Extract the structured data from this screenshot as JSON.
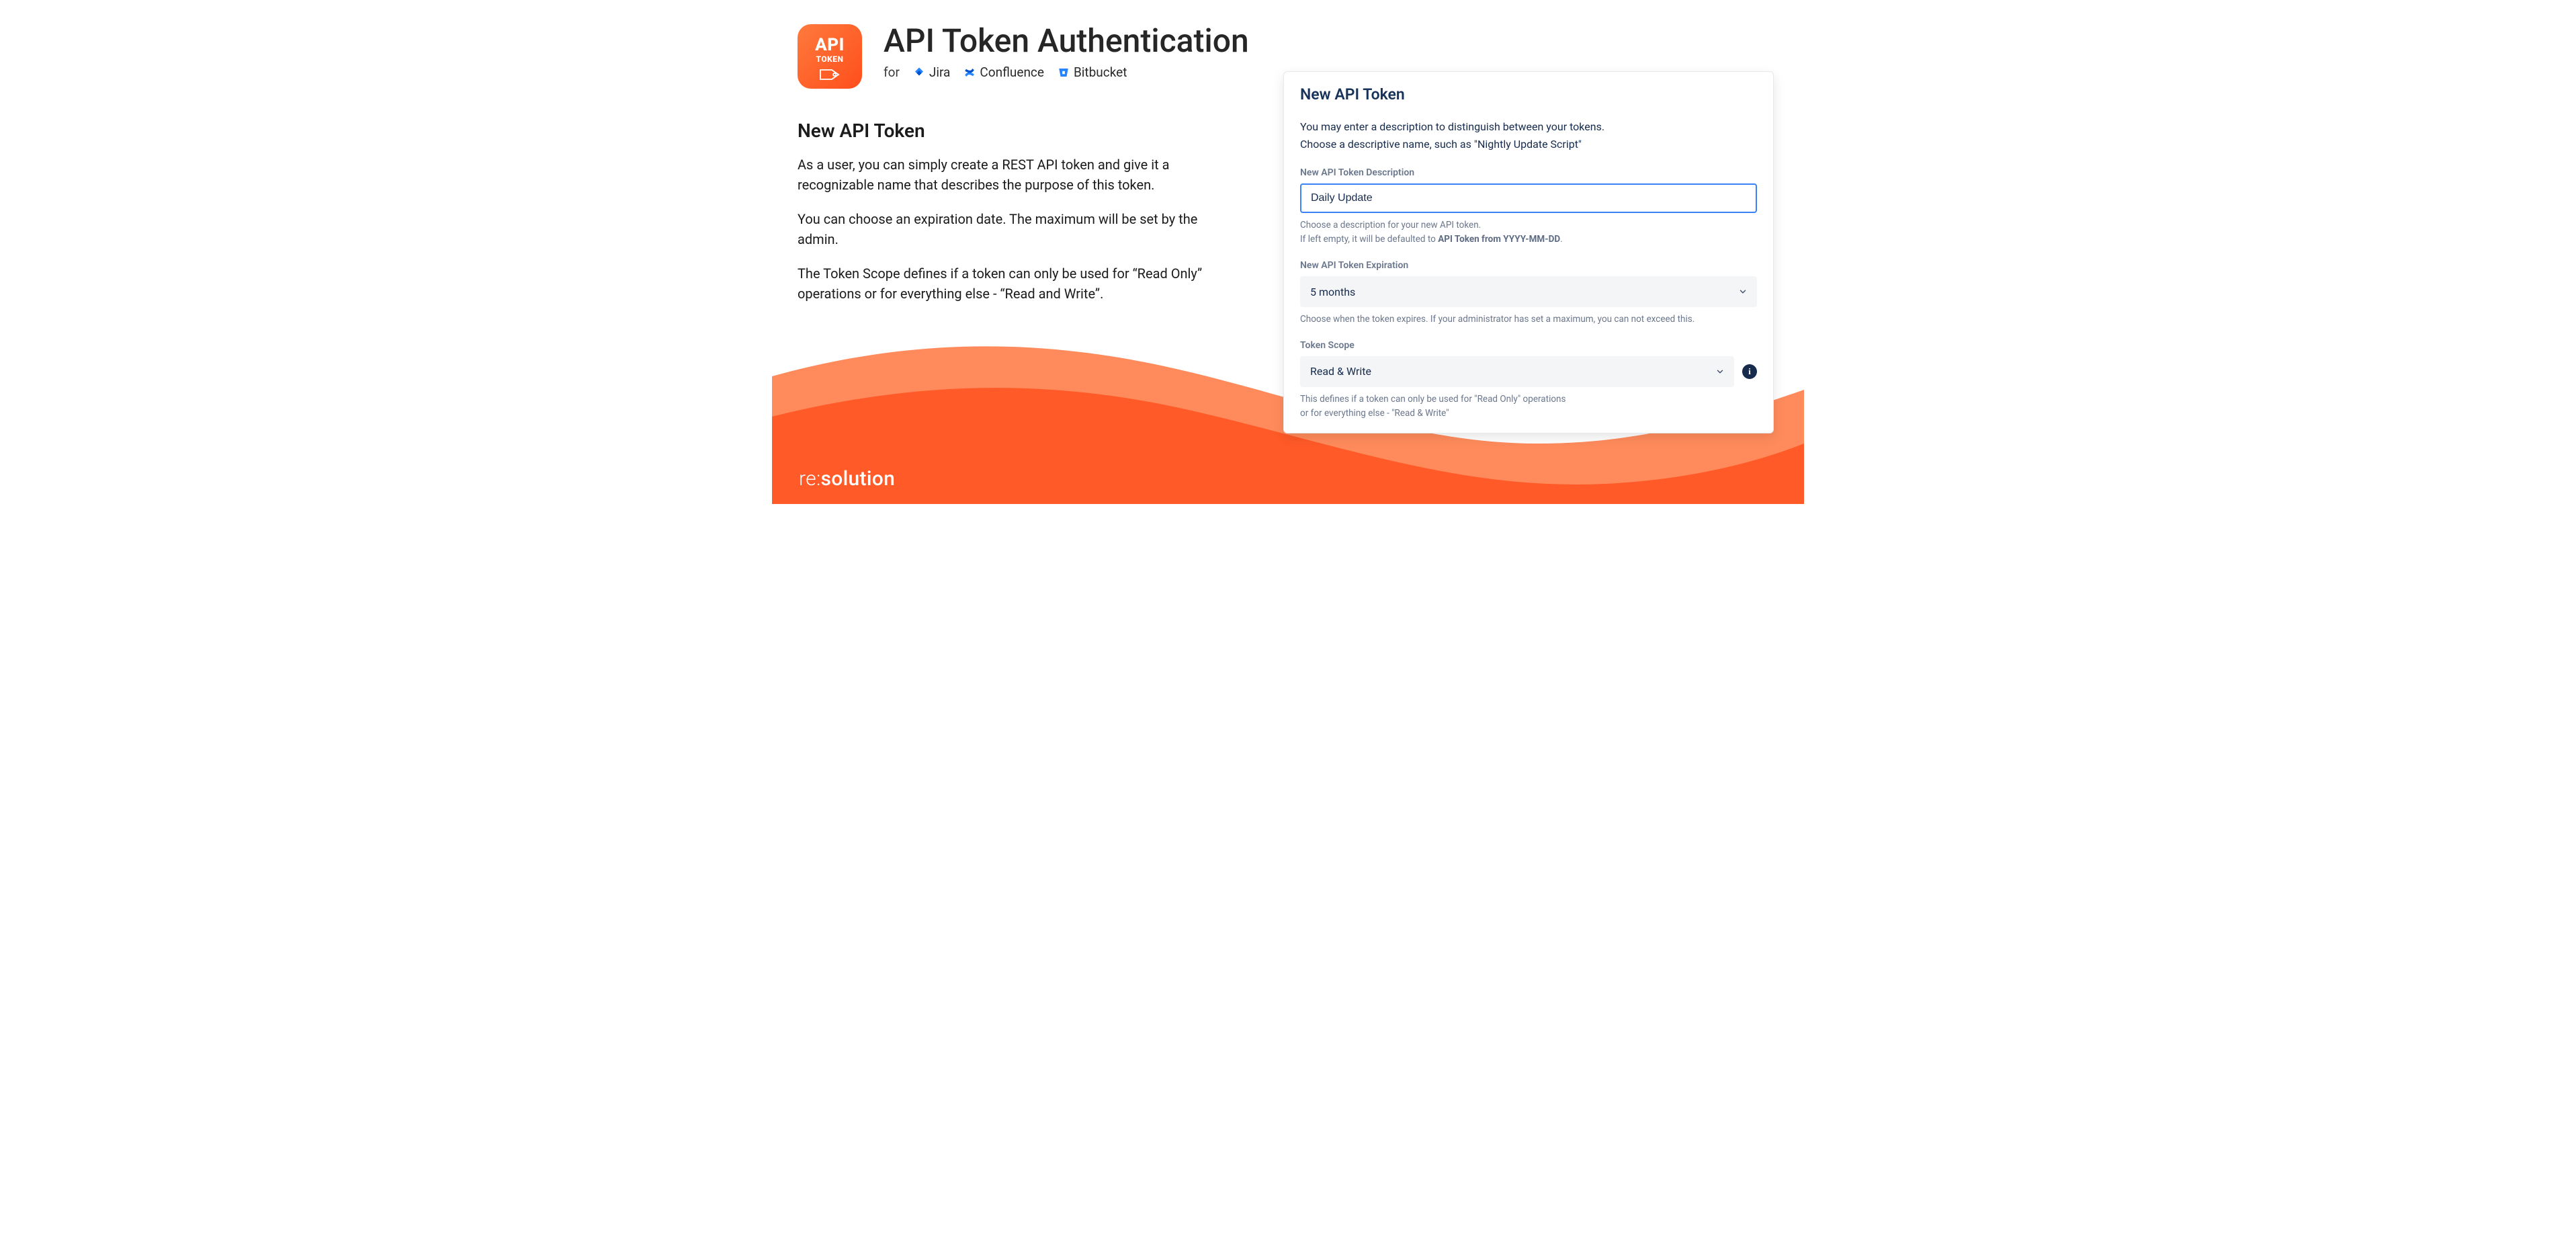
{
  "header": {
    "logo": {
      "line1": "API",
      "line2": "TOKEN"
    },
    "title": "API Token Authentication",
    "for_label": "for",
    "products": [
      {
        "key": "jira",
        "label": "Jira"
      },
      {
        "key": "confluence",
        "label": "Confluence"
      },
      {
        "key": "bitbucket",
        "label": "Bitbucket"
      }
    ]
  },
  "left": {
    "heading": "New API Token",
    "p1": "As a user, you can simply create a REST API token and give it a recognizable name that describes the purpose of this token.",
    "p2": "You can choose an expiration date. The maximum will be set by the admin.",
    "p3": "The Token Scope defines if a token can only be used for “Read Only” operations or for everything else - “Read and Write”."
  },
  "panel": {
    "title": "New API Token",
    "intro_line1": "You may enter a description to distinguish between your tokens.",
    "intro_line2": "Choose a descriptive name, such as \"Nightly Update Script\"",
    "desc_label": "New API Token Description",
    "desc_value": "Daily Update",
    "desc_hint_1": "Choose a description for your new API token.",
    "desc_hint_2_prefix": "If left empty, it will be defaulted to ",
    "desc_hint_2_bold": "API Token from YYYY-MM-DD",
    "desc_hint_2_suffix": ".",
    "exp_label": "New API Token Expiration",
    "exp_value": "5 months",
    "exp_hint": "Choose when the token expires. If your administrator has set a maximum, you can not exceed this.",
    "scope_label": "Token Scope",
    "scope_value": "Read & Write",
    "scope_hint_1": "This defines if a token can only be used for \"Read Only\" operations",
    "scope_hint_2": "or for everything else - \"Read & Write\"",
    "info_label": "i"
  },
  "brand": {
    "pre": "re:",
    "post": "solution"
  },
  "colors": {
    "orange_light": "#ff8b5c",
    "orange_dark": "#ff5a27",
    "blue_focus": "#3b82f6",
    "text_dark": "#172b4d",
    "muted": "#6b778c"
  }
}
